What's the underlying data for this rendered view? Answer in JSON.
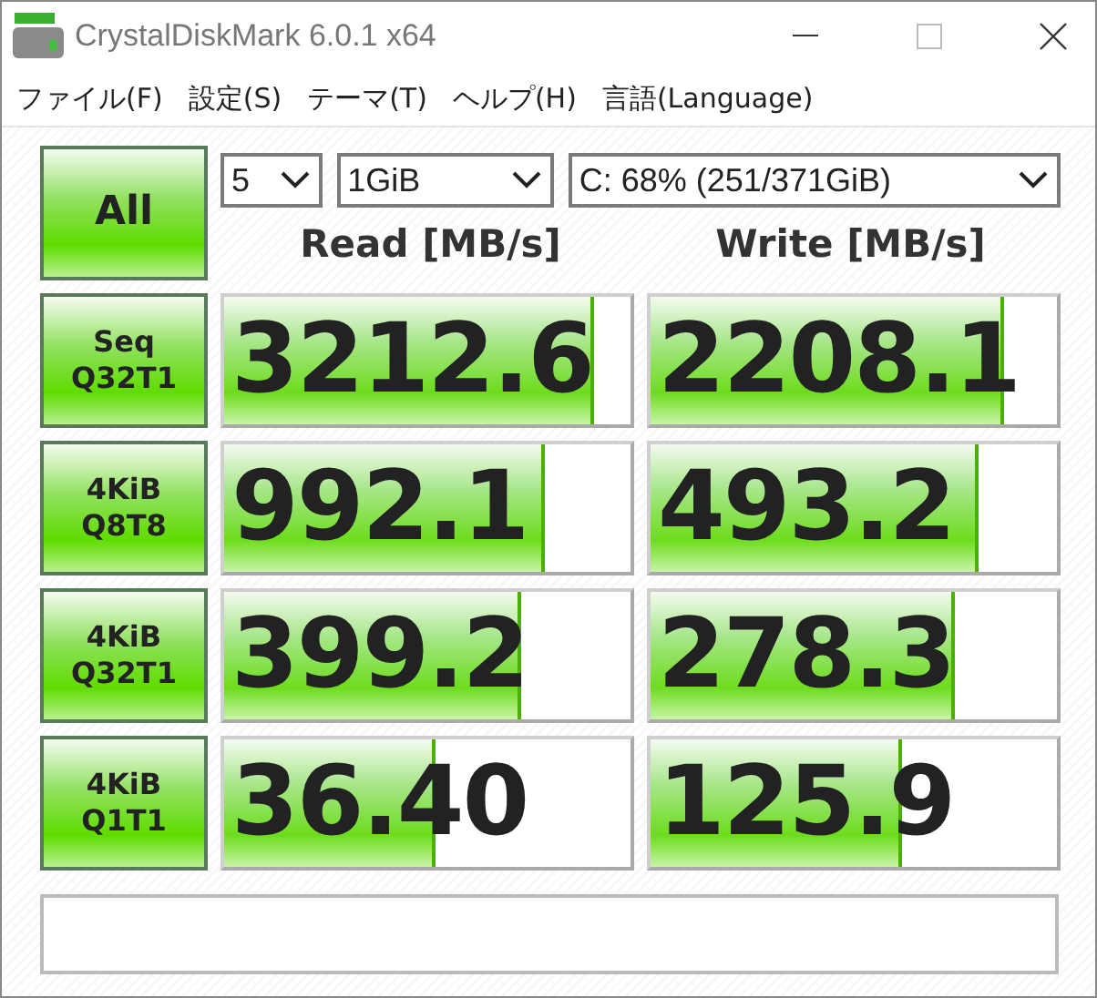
{
  "window": {
    "title": "CrystalDiskMark 6.0.1 x64"
  },
  "menu": [
    "ファイル(F)",
    "設定(S)",
    "テーマ(T)",
    "ヘルプ(H)",
    "言語(Language)"
  ],
  "all_button": "All",
  "selects": [
    {
      "value": "5"
    },
    {
      "value": "1GiB"
    },
    {
      "value": "C: 68% (251/371GiB)"
    }
  ],
  "headers": [
    "Read [MB/s]",
    "Write [MB/s]"
  ],
  "rows": [
    {
      "test": [
        "Seq",
        "Q32T1"
      ],
      "read": {
        "reading": "3212.6",
        "level": 0.9
      },
      "write": {
        "reading": "2208.1",
        "level": 0.86
      }
    },
    {
      "test": [
        "4KiB",
        "Q8T8"
      ],
      "read": {
        "reading": "992.1",
        "level": 0.78
      },
      "write": {
        "reading": "493.2",
        "level": 0.8
      }
    },
    {
      "test": [
        "4KiB",
        "Q32T1"
      ],
      "read": {
        "reading": "399.2",
        "level": 0.72
      },
      "write": {
        "reading": "278.3",
        "level": 0.74
      }
    },
    {
      "test": [
        "4KiB",
        "Q1T1"
      ],
      "read": {
        "reading": "36.40",
        "level": 0.51
      },
      "write": {
        "reading": "125.9",
        "level": 0.61
      }
    }
  ]
}
